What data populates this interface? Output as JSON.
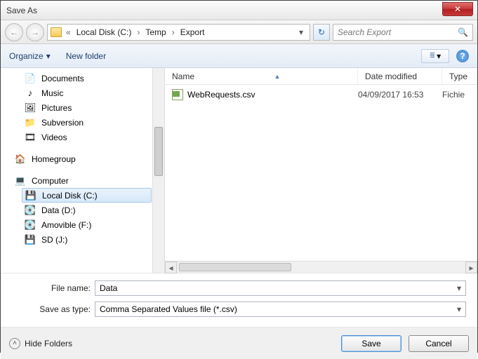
{
  "window": {
    "title": "Save As",
    "close": "✕"
  },
  "nav": {
    "back": "←",
    "fwd": "→",
    "crumbs": [
      "Local Disk (C:)",
      "Temp",
      "Export"
    ],
    "sep": "›",
    "dd": "▾",
    "refresh": "↻",
    "search_placeholder": "Search Export",
    "search_icon": "🔍"
  },
  "toolbar": {
    "organize": "Organize",
    "organize_dd": "▾",
    "new_folder": "New folder",
    "view_dd": "▾",
    "help": "?"
  },
  "tree": {
    "items": [
      {
        "icon": "📄",
        "label": "Documents",
        "indent": 1
      },
      {
        "icon": "♪",
        "label": "Music",
        "indent": 1
      },
      {
        "icon": "🖼",
        "label": "Pictures",
        "indent": 1
      },
      {
        "icon": "📁",
        "label": "Subversion",
        "indent": 1
      },
      {
        "icon": "🎞",
        "label": "Videos",
        "indent": 1
      }
    ],
    "homegroup": {
      "icon": "🏠",
      "label": "Homegroup"
    },
    "computer": {
      "icon": "💻",
      "label": "Computer"
    },
    "drives": [
      {
        "icon": "💾",
        "label": "Local Disk (C:)",
        "selected": true
      },
      {
        "icon": "💽",
        "label": "Data (D:)"
      },
      {
        "icon": "💽",
        "label": "Amovible (F:)"
      },
      {
        "icon": "💾",
        "label": "SD (J:)"
      }
    ]
  },
  "columns": {
    "name": "Name",
    "date": "Date modified",
    "type": "Type",
    "sort": "▲"
  },
  "files": [
    {
      "name": "WebRequests.csv",
      "date": "04/09/2017 16:53",
      "type": "Fichie"
    }
  ],
  "form": {
    "filename_label": "File name:",
    "filename_value": "Data",
    "type_label": "Save as type:",
    "type_value": "Comma Separated Values file (*.csv)",
    "dd": "▾"
  },
  "footer": {
    "hide": "Hide Folders",
    "chev": "˄",
    "save": "Save",
    "cancel": "Cancel"
  }
}
